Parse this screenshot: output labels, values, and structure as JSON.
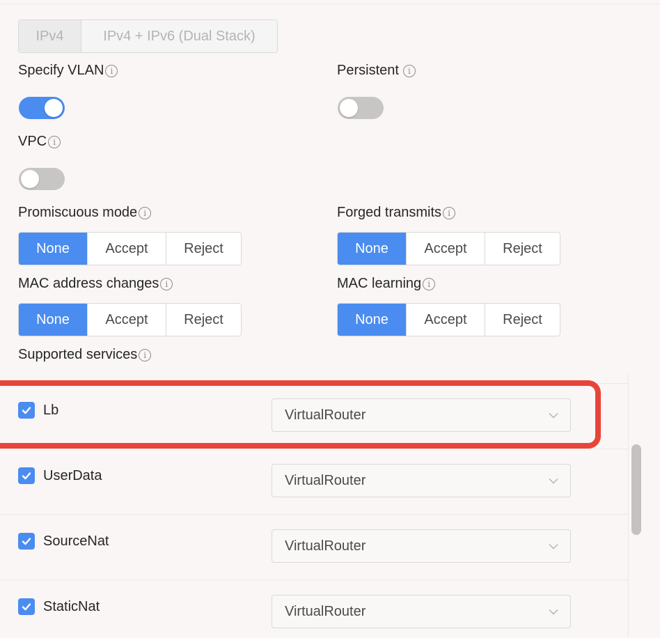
{
  "ip_version": {
    "options": [
      "IPv4",
      "IPv4 + IPv6 (Dual Stack)"
    ],
    "selected": "IPv4"
  },
  "specify_vlan": {
    "label": "Specify VLAN",
    "value": true
  },
  "persistent": {
    "label": "Persistent",
    "value": false
  },
  "vpc": {
    "label": "VPC",
    "value": false
  },
  "promiscuous_mode": {
    "label": "Promiscuous mode",
    "options": [
      "None",
      "Accept",
      "Reject"
    ],
    "selected": "None"
  },
  "forged_transmits": {
    "label": "Forged transmits",
    "options": [
      "None",
      "Accept",
      "Reject"
    ],
    "selected": "None"
  },
  "mac_address_changes": {
    "label": "MAC address changes",
    "options": [
      "None",
      "Accept",
      "Reject"
    ],
    "selected": "None"
  },
  "mac_learning": {
    "label": "MAC learning",
    "options": [
      "None",
      "Accept",
      "Reject"
    ],
    "selected": "None"
  },
  "supported_services": {
    "label": "Supported services",
    "items": [
      {
        "name": "Lb",
        "checked": true,
        "provider": "VirtualRouter"
      },
      {
        "name": "UserData",
        "checked": true,
        "provider": "VirtualRouter"
      },
      {
        "name": "SourceNat",
        "checked": true,
        "provider": "VirtualRouter"
      },
      {
        "name": "StaticNat",
        "checked": true,
        "provider": "VirtualRouter"
      }
    ]
  },
  "info_glyph": "i",
  "colors": {
    "accent": "#4a8cf0",
    "highlight": "#e8443a"
  },
  "icons": {
    "info": "info-circle-icon",
    "check": "check-icon",
    "chevron": "chevron-down-icon"
  }
}
